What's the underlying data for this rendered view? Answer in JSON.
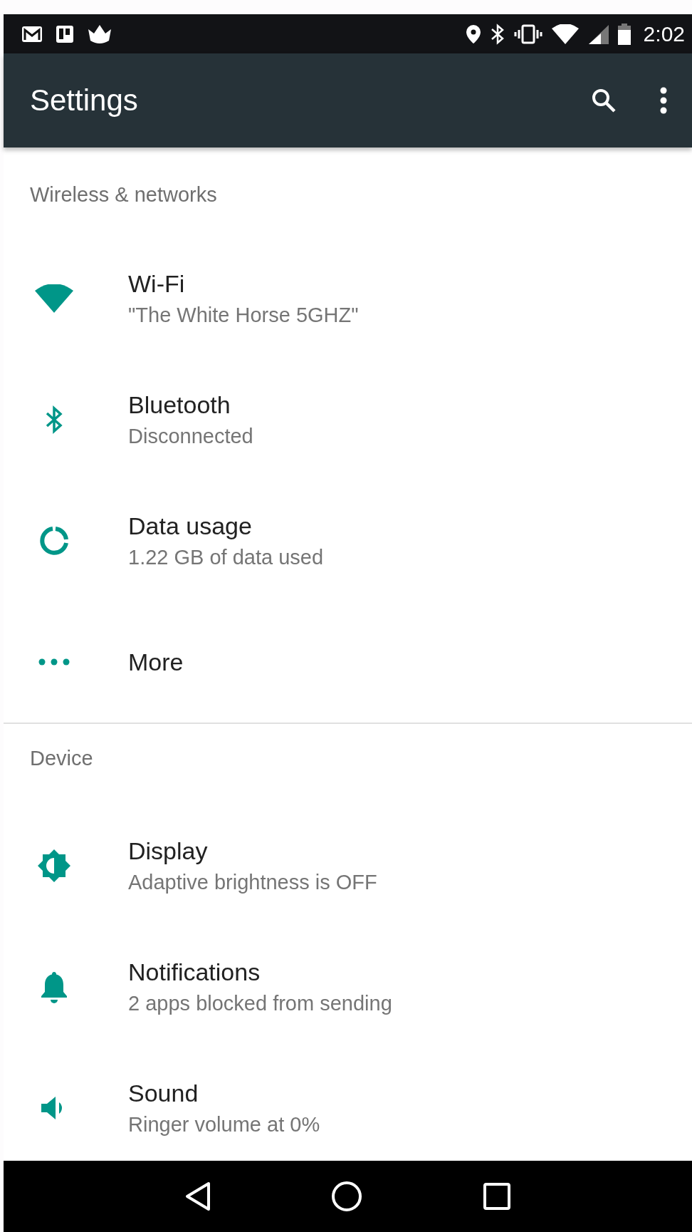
{
  "status_bar": {
    "time": "2:02"
  },
  "app_bar": {
    "title": "Settings"
  },
  "sections": [
    {
      "header": "Wireless & networks",
      "items": [
        {
          "title": "Wi-Fi",
          "subtitle": "\"The White Horse 5GHZ\""
        },
        {
          "title": "Bluetooth",
          "subtitle": "Disconnected"
        },
        {
          "title": "Data usage",
          "subtitle": "1.22 GB of data used"
        },
        {
          "title": "More"
        }
      ]
    },
    {
      "header": "Device",
      "items": [
        {
          "title": "Display",
          "subtitle": "Adaptive brightness is OFF"
        },
        {
          "title": "Notifications",
          "subtitle": "2 apps blocked from sending"
        },
        {
          "title": "Sound",
          "subtitle": "Ringer volume at 0%"
        }
      ]
    }
  ]
}
